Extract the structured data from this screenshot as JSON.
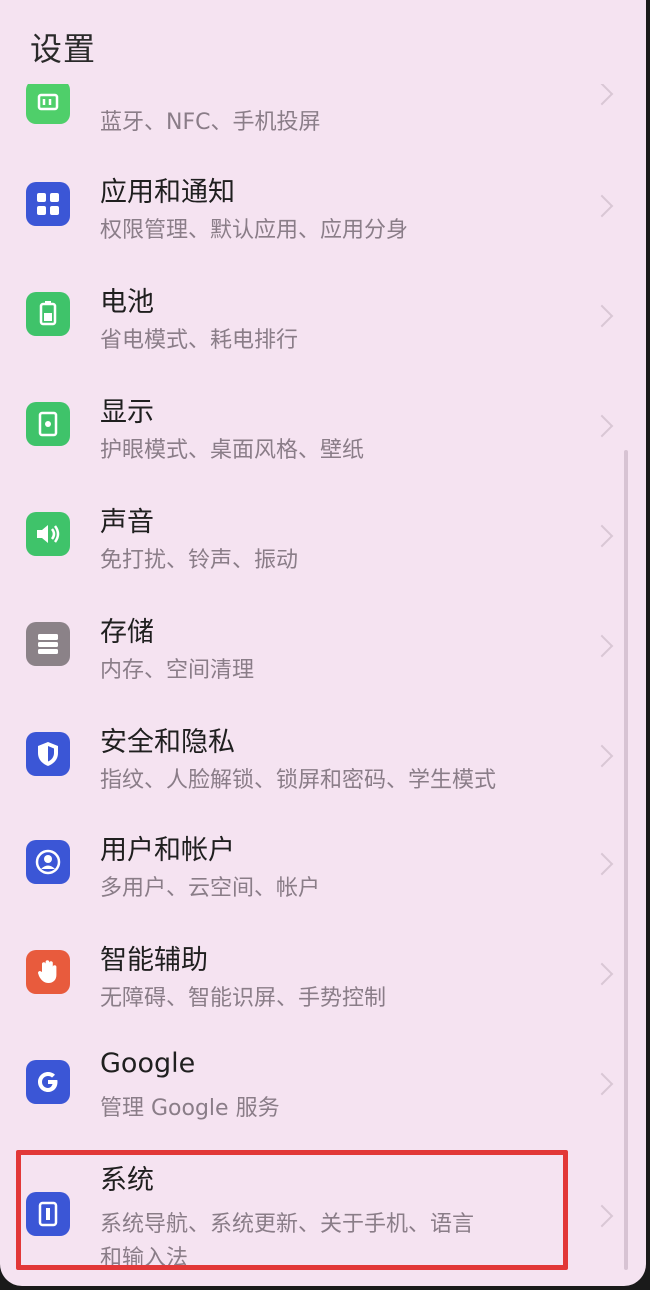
{
  "header": {
    "title": "设置"
  },
  "items": [
    {
      "title": "",
      "subtitle": "蓝牙、NFC、手机投屏",
      "icon": "device-connection-icon",
      "color": "#4fcf6a"
    },
    {
      "title": "应用和通知",
      "subtitle": "权限管理、默认应用、应用分身",
      "icon": "apps-grid-icon",
      "color": "#3b56d6"
    },
    {
      "title": "电池",
      "subtitle": "省电模式、耗电排行",
      "icon": "battery-icon",
      "color": "#3fc36a"
    },
    {
      "title": "显示",
      "subtitle": "护眼模式、桌面风格、壁纸",
      "icon": "display-icon",
      "color": "#3fc36a"
    },
    {
      "title": "声音",
      "subtitle": "免打扰、铃声、振动",
      "icon": "speaker-icon",
      "color": "#3fc36a"
    },
    {
      "title": "存储",
      "subtitle": "内存、空间清理",
      "icon": "storage-icon",
      "color": "#8b8288"
    },
    {
      "title": "安全和隐私",
      "subtitle": "指纹、人脸解锁、锁屏和密码、学生模式",
      "icon": "shield-icon",
      "color": "#3b56d6"
    },
    {
      "title": "用户和帐户",
      "subtitle": "多用户、云空间、帐户",
      "icon": "user-account-icon",
      "color": "#3b56d6"
    },
    {
      "title": "智能辅助",
      "subtitle": "无障碍、智能识屏、手势控制",
      "icon": "hand-icon",
      "color": "#e85b3d"
    },
    {
      "title": "Google",
      "subtitle": "管理 Google 服务",
      "icon": "google-icon",
      "color": "#3b56d6"
    },
    {
      "title": "系统",
      "subtitle": "系统导航、系统更新、关于手机、语言",
      "subtitle2": "和输入法",
      "icon": "system-phone-icon",
      "color": "#3b56d6"
    }
  ]
}
